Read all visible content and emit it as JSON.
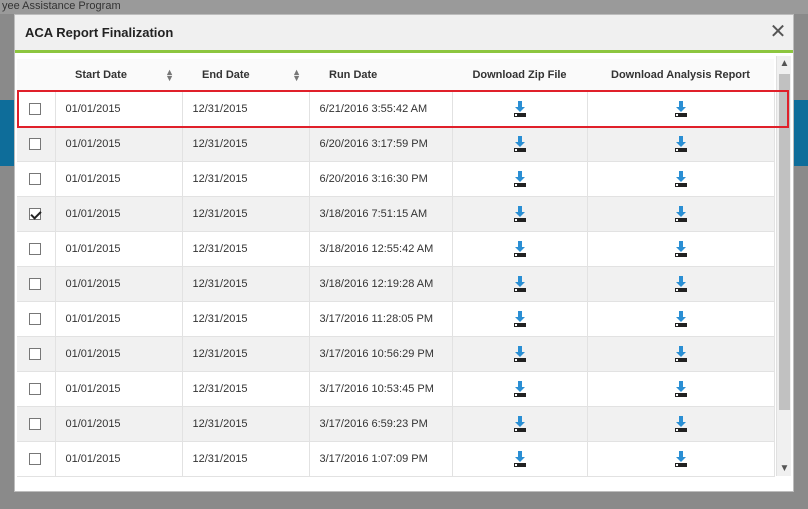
{
  "background": {
    "top_text": "yee Assistance Program"
  },
  "dialog": {
    "title": "ACA Report Finalization",
    "close_symbol": "✕"
  },
  "columns": [
    {
      "label": ""
    },
    {
      "label": "Start Date",
      "sortable": true
    },
    {
      "label": "End Date",
      "sortable": true
    },
    {
      "label": "Run Date",
      "sortable": false
    },
    {
      "label": "Download Zip File",
      "sortable": false
    },
    {
      "label": "Download Analysis Report",
      "sortable": false
    }
  ],
  "rows": [
    {
      "checked": false,
      "start": "01/01/2015",
      "end": "12/31/2015",
      "run": "6/21/2016 3:55:42 AM"
    },
    {
      "checked": false,
      "start": "01/01/2015",
      "end": "12/31/2015",
      "run": "6/20/2016 3:17:59 PM"
    },
    {
      "checked": false,
      "start": "01/01/2015",
      "end": "12/31/2015",
      "run": "6/20/2016 3:16:30 PM"
    },
    {
      "checked": true,
      "start": "01/01/2015",
      "end": "12/31/2015",
      "run": "3/18/2016 7:51:15 AM"
    },
    {
      "checked": false,
      "start": "01/01/2015",
      "end": "12/31/2015",
      "run": "3/18/2016 12:55:42 AM"
    },
    {
      "checked": false,
      "start": "01/01/2015",
      "end": "12/31/2015",
      "run": "3/18/2016 12:19:28 AM"
    },
    {
      "checked": false,
      "start": "01/01/2015",
      "end": "12/31/2015",
      "run": "3/17/2016 11:28:05 PM"
    },
    {
      "checked": false,
      "start": "01/01/2015",
      "end": "12/31/2015",
      "run": "3/17/2016 10:56:29 PM"
    },
    {
      "checked": false,
      "start": "01/01/2015",
      "end": "12/31/2015",
      "run": "3/17/2016 10:53:45 PM"
    },
    {
      "checked": false,
      "start": "01/01/2015",
      "end": "12/31/2015",
      "run": "3/17/2016 6:59:23 PM"
    },
    {
      "checked": false,
      "start": "01/01/2015",
      "end": "12/31/2015",
      "run": "3/17/2016 1:07:09 PM"
    }
  ],
  "icons": {
    "download": "download-icon",
    "sort": "sort-icon",
    "close": "close-icon"
  },
  "colors": {
    "accent": "#8dc63f",
    "download_blue": "#2a8fd4",
    "highlight": "#e0202a"
  }
}
